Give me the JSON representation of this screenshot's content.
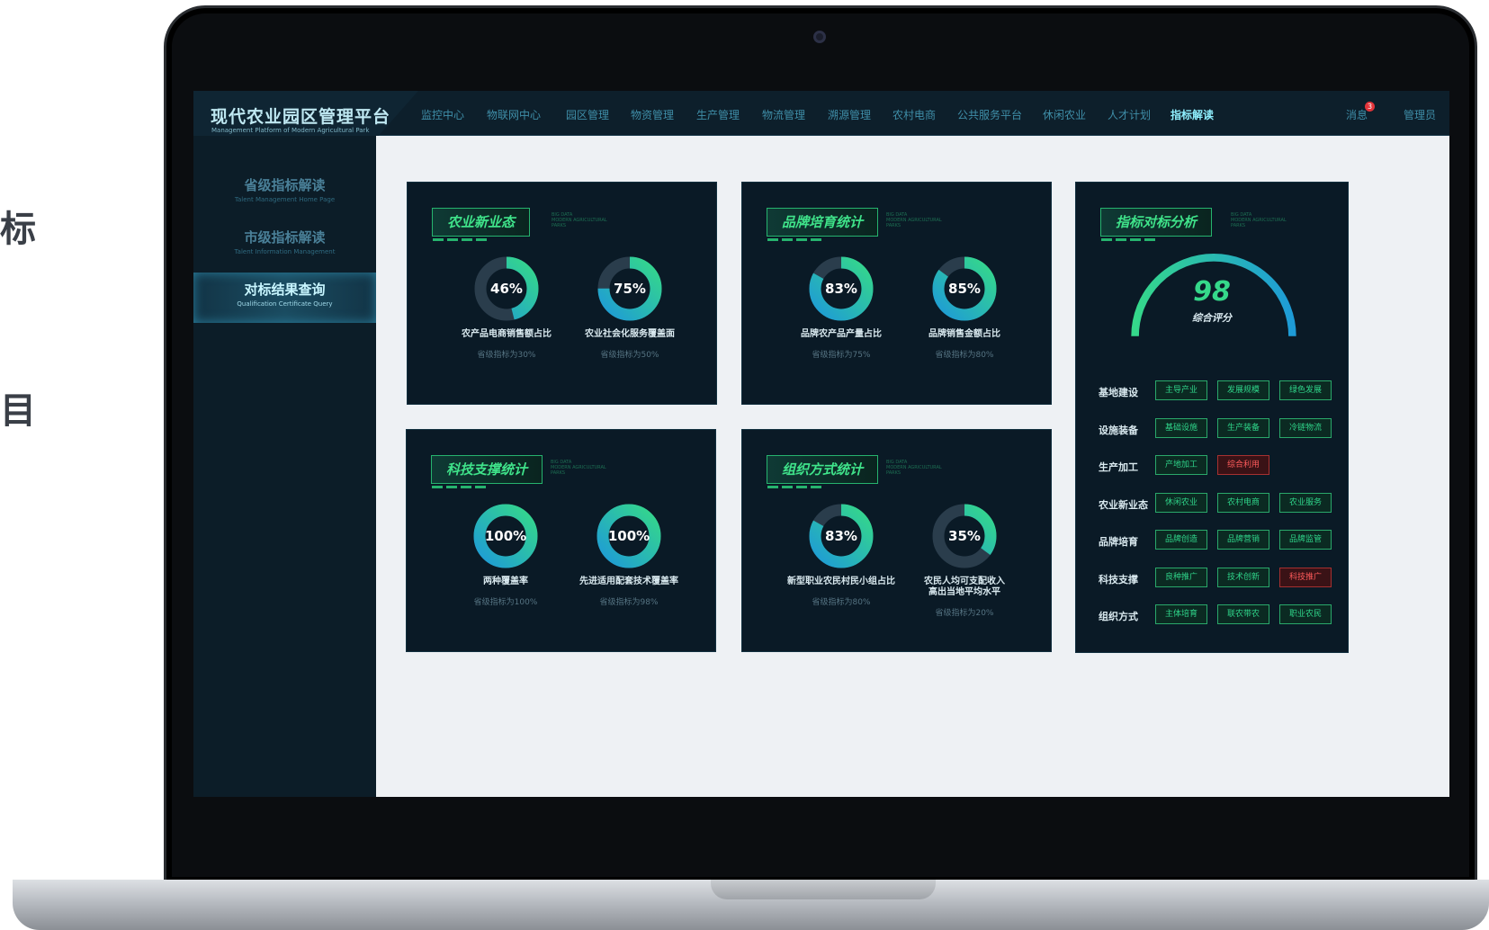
{
  "edge_texts": [
    "标",
    "目",
    ""
  ],
  "header": {
    "title": "现代农业园区管理平台",
    "subtitle": "Management Platform of Modern Agricultural Park",
    "nav": [
      "监控中心",
      "物联网中心",
      "园区管理",
      "物资管理",
      "生产管理",
      "物流管理",
      "溯源管理",
      "农村电商",
      "公共服务平台",
      "休闲农业",
      "人才计划",
      "指标解读"
    ],
    "active_nav": "指标解读",
    "messages_label": "消息",
    "messages_count": "3",
    "user_label": "管理员"
  },
  "sidebar": {
    "items": [
      {
        "label": "省级指标解读",
        "sub": "Talent Management Home Page"
      },
      {
        "label": "市级指标解读",
        "sub": "Talent Information Management"
      },
      {
        "label": "对标结果查询",
        "sub": "Qualification Certificate Query"
      }
    ],
    "active": "对标结果查询"
  },
  "tag_text": [
    "BIG DATA",
    "MODERN AGRICULTURAL",
    "PARKS"
  ],
  "panels": [
    {
      "title": "农业新业态",
      "donuts": [
        {
          "value": 46,
          "label": "农产品电商销售额占比",
          "sub": "省级指标为30%"
        },
        {
          "value": 75,
          "label": "农业社会化服务覆盖面",
          "sub": "省级指标为50%"
        }
      ]
    },
    {
      "title": "品牌培育统计",
      "donuts": [
        {
          "value": 83,
          "label": "品牌农产品产量占比",
          "sub": "省级指标为75%"
        },
        {
          "value": 85,
          "label": "品牌销售金额占比",
          "sub": "省级指标为80%"
        }
      ]
    },
    {
      "title": "科技支撑统计",
      "donuts": [
        {
          "value": 100,
          "label": "两种覆盖率",
          "sub": "省级指标为100%"
        },
        {
          "value": 100,
          "label": "先进适用配套技术覆盖率",
          "sub": "省级指标为98%"
        }
      ]
    },
    {
      "title": "组织方式统计",
      "donuts": [
        {
          "value": 83,
          "label": "新型职业农民村民小组占比",
          "sub": "省级指标为80%"
        },
        {
          "value": 35,
          "label": "农民人均可支配收入\n高出当地平均水平",
          "sub": "省级指标为20%"
        }
      ]
    }
  ],
  "analysis": {
    "title": "指标对标分析",
    "score": 98,
    "score_label": "综合评分",
    "rows": [
      {
        "label": "基地建设",
        "tags": [
          {
            "text": "主导产业",
            "warn": false
          },
          {
            "text": "发展规模",
            "warn": false
          },
          {
            "text": "绿色发展",
            "warn": false
          }
        ]
      },
      {
        "label": "设施装备",
        "tags": [
          {
            "text": "基础设施",
            "warn": false
          },
          {
            "text": "生产装备",
            "warn": false
          },
          {
            "text": "冷链物流",
            "warn": false
          }
        ]
      },
      {
        "label": "生产加工",
        "tags": [
          {
            "text": "产地加工",
            "warn": false
          },
          {
            "text": "综合利用",
            "warn": true
          }
        ]
      },
      {
        "label": "农业新业态",
        "tags": [
          {
            "text": "休闲农业",
            "warn": false
          },
          {
            "text": "农村电商",
            "warn": false
          },
          {
            "text": "农业服务",
            "warn": false
          }
        ]
      },
      {
        "label": "品牌培育",
        "tags": [
          {
            "text": "品牌创造",
            "warn": false
          },
          {
            "text": "品牌营销",
            "warn": false
          },
          {
            "text": "品牌监管",
            "warn": false
          }
        ]
      },
      {
        "label": "科技支撑",
        "tags": [
          {
            "text": "良种推广",
            "warn": false
          },
          {
            "text": "技术创新",
            "warn": false
          },
          {
            "text": "科技推广",
            "warn": true
          }
        ]
      },
      {
        "label": "组织方式",
        "tags": [
          {
            "text": "主体培育",
            "warn": false
          },
          {
            "text": "联农带农",
            "warn": false
          },
          {
            "text": "职业农民",
            "warn": false
          }
        ]
      }
    ]
  },
  "colors": {
    "accent_green": "#35d88a",
    "accent_blue": "#1e9bd7",
    "warn_red": "#ff5b5b"
  }
}
